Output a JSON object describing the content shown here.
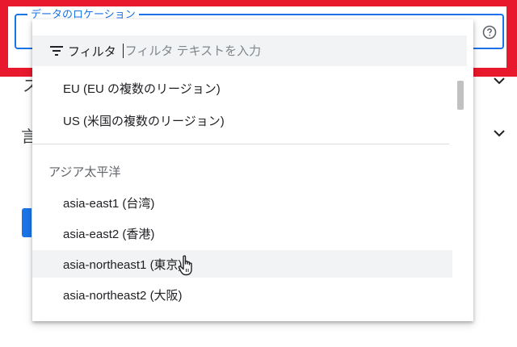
{
  "field": {
    "label": "データのロケーション"
  },
  "filter": {
    "label": "フィルタ",
    "placeholder": "フィルタ テキストを入力"
  },
  "options_top": [
    {
      "label": "EU (EU の複数のリージョン)"
    },
    {
      "label": "US (米国の複数のリージョン)"
    }
  ],
  "group": {
    "header": "アジア太平洋"
  },
  "options_asia": [
    {
      "label": "asia-east1 (台湾)"
    },
    {
      "label": "asia-east2 (香港)"
    },
    {
      "label": "asia-northeast1 (東京)"
    },
    {
      "label": "asia-northeast2 (大阪)"
    }
  ],
  "colors": {
    "highlight": "#e8192c",
    "accent": "#1a73e8",
    "hover": "#f1f3f4"
  },
  "icons": [
    "help-icon",
    "filter-icon",
    "chevron-down-icon",
    "hand-cursor-icon"
  ]
}
